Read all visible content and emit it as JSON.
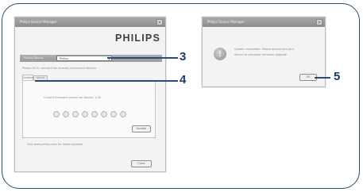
{
  "left_window": {
    "title": "Philips Device Manager",
    "brand": "PHILIPS",
    "device_label": "Philips Device",
    "device_value": "Philips",
    "instructions": "Please fill in, connect the recently connected devices",
    "tab_update": "Update",
    "tab_about": "About",
    "firmware_text": "Current firmware version on device: 1.00",
    "update_button": "Update",
    "visit_text": "Visit www.philips.com for latest updates",
    "close_button": "Close"
  },
  "right_window": {
    "title": "Philips Device Manager",
    "message_line1": "Update completed. Please disconnect your",
    "message_line2": "device to complete firmware upgrade",
    "ok_button": "OK"
  },
  "callouts": {
    "c3": "3",
    "c4": "4",
    "c5": "5"
  },
  "colors": {
    "frame": "#2a4a7a",
    "callout": "#1e3a66",
    "title_bar": "#999999"
  }
}
